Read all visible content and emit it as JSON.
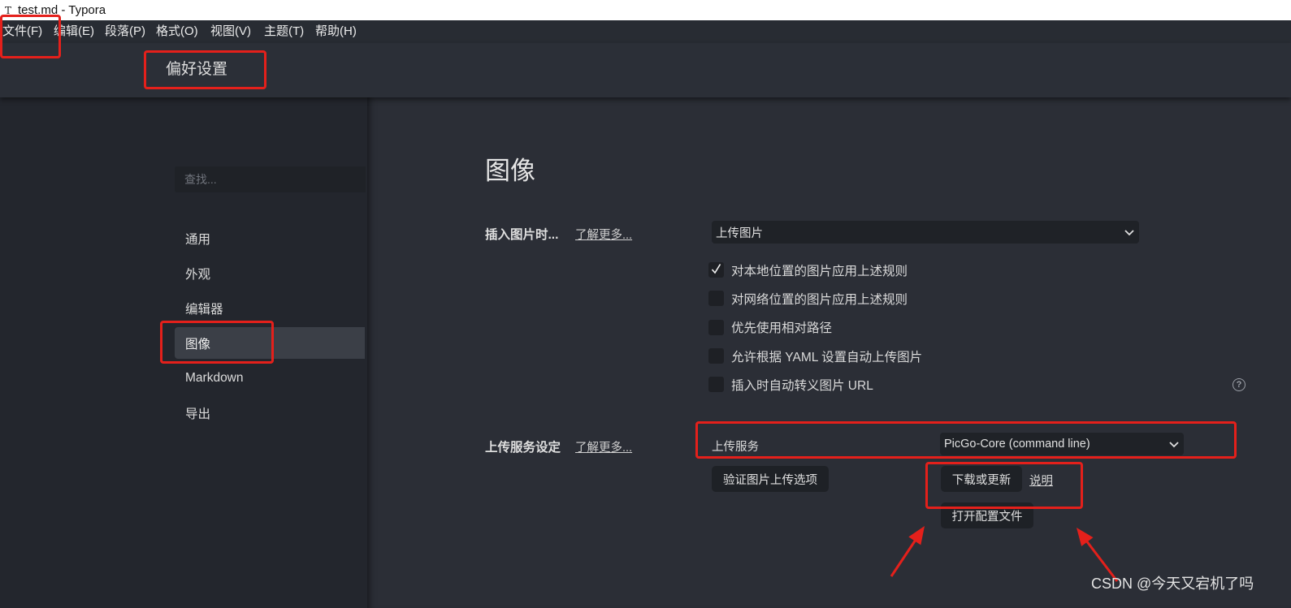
{
  "window": {
    "app_icon": "T",
    "title": "test.md - Typora"
  },
  "menu": {
    "items": [
      "文件(F)",
      "编辑(E)",
      "段落(P)",
      "格式(O)",
      "视图(V)",
      "主题(T)",
      "帮助(H)"
    ]
  },
  "header": {
    "title": "偏好设置"
  },
  "sidebar": {
    "search_placeholder": "查找...",
    "items": [
      {
        "label": "通用",
        "selected": false
      },
      {
        "label": "外观",
        "selected": false
      },
      {
        "label": "编辑器",
        "selected": false
      },
      {
        "label": "图像",
        "selected": true
      },
      {
        "label": "Markdown",
        "selected": false
      },
      {
        "label": "导出",
        "selected": false
      }
    ]
  },
  "main": {
    "title": "图像",
    "insert": {
      "label": "插入图片时...",
      "learn_more": "了解更多...",
      "select_value": "上传图片"
    },
    "checkboxes": [
      {
        "label": "对本地位置的图片应用上述规则",
        "checked": true
      },
      {
        "label": "对网络位置的图片应用上述规则",
        "checked": false
      },
      {
        "label": "优先使用相对路径",
        "checked": false
      },
      {
        "label": "允许根据 YAML 设置自动上传图片",
        "checked": false
      },
      {
        "label": "插入时自动转义图片 URL",
        "checked": false
      }
    ],
    "help_symbol": "?",
    "upload": {
      "label": "上传服务设定",
      "learn_more": "了解更多...",
      "service_label": "上传服务",
      "service_value": "PicGo-Core (command line)",
      "verify_button": "验证图片上传选项",
      "download_button": "下载或更新",
      "docs_link": "说明",
      "open_config_button": "打开配置文件"
    }
  },
  "watermark": "CSDN @今天又宕机了吗",
  "icons": {
    "select_arrow": "chevron-down-icon",
    "checkbox_mark": "check-icon",
    "help": "help-icon"
  },
  "colors": {
    "titlebar_bg": "#ffffff",
    "menubar_bg": "#282c33",
    "sidebar_bg": "#23262d",
    "content_bg": "#2b2e36",
    "selected_nav_bg": "#3b3f47",
    "control_bg": "#1f2227",
    "annotation_red": "#e4201b"
  }
}
